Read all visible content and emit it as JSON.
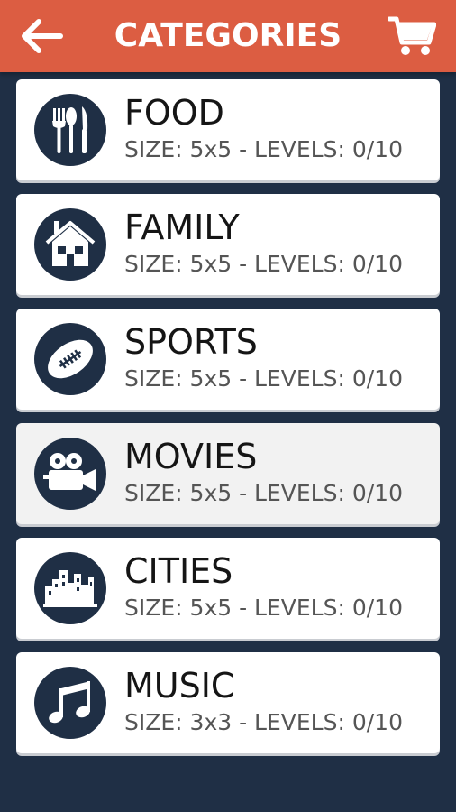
{
  "header": {
    "title": "CATEGORIES",
    "back_icon": "arrow-left-icon",
    "cart_icon": "cart-icon"
  },
  "colors": {
    "header_bg": "#dc5d42",
    "page_bg": "#1f2f45",
    "card_bg": "#ffffff",
    "card_selected_bg": "#f2f2f2",
    "icon_bg": "#1f2f45"
  },
  "categories": [
    {
      "name": "FOOD",
      "meta": "SIZE: 5x5 - LEVELS: 0/10",
      "icon": "cutlery-icon",
      "selected": false
    },
    {
      "name": "FAMILY",
      "meta": "SIZE: 5x5 - LEVELS: 0/10",
      "icon": "house-icon",
      "selected": false
    },
    {
      "name": "SPORTS",
      "meta": "SIZE: 5x5 - LEVELS: 0/10",
      "icon": "football-icon",
      "selected": false
    },
    {
      "name": "MOVIES",
      "meta": "SIZE: 5x5 - LEVELS: 0/10",
      "icon": "movie-camera-icon",
      "selected": true
    },
    {
      "name": "CITIES",
      "meta": "SIZE: 5x5 - LEVELS: 0/10",
      "icon": "city-icon",
      "selected": false
    },
    {
      "name": "MUSIC",
      "meta": "SIZE: 3x3 - LEVELS: 0/10",
      "icon": "music-note-icon",
      "selected": false
    }
  ]
}
